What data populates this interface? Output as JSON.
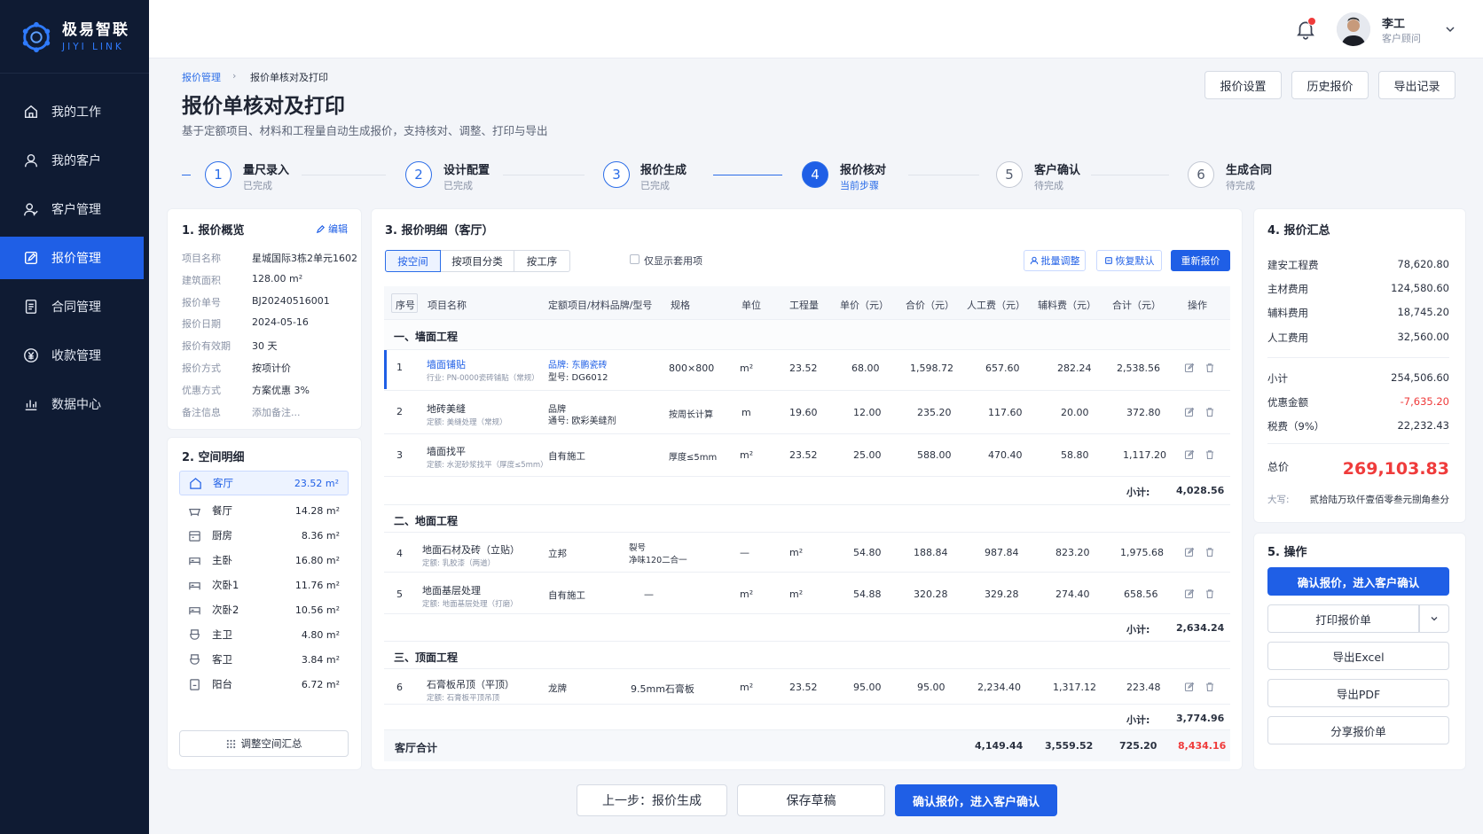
{
  "brand": {
    "name_cn": "极易智联",
    "name_en": "JIYI LINK"
  },
  "nav": [
    {
      "label": "我的工作",
      "icon": "home-icon"
    },
    {
      "label": "我的客户",
      "icon": "user-icon"
    },
    {
      "label": "客户管理",
      "icon": "users-icon"
    },
    {
      "label": "报价管理",
      "icon": "edit-icon",
      "active": true
    },
    {
      "label": "合同管理",
      "icon": "document-icon"
    },
    {
      "label": "收款管理",
      "icon": "yen-icon"
    },
    {
      "label": "数据中心",
      "icon": "chart-icon"
    }
  ],
  "user": {
    "name": "李工",
    "role": "客户顾问"
  },
  "breadcrumb": {
    "parent": "报价管理",
    "current": "报价单核对及打印"
  },
  "page": {
    "title": "报价单核对及打印",
    "subtitle": "基于定额项目、材料和工程量自动生成报价，支持核对、调整、打印与导出"
  },
  "header_buttons": [
    "报价设置",
    "历史报价",
    "导出记录"
  ],
  "steps": [
    {
      "num": "1",
      "label": "量尺录入",
      "status": "已完成"
    },
    {
      "num": "2",
      "label": "设计配置",
      "status": "已完成"
    },
    {
      "num": "3",
      "label": "报价生成",
      "status": "已完成"
    },
    {
      "num": "4",
      "label": "报价核对",
      "status": "当前步骤"
    },
    {
      "num": "5",
      "label": "客户确认",
      "status": "待完成"
    },
    {
      "num": "6",
      "label": "生成合同",
      "status": "待完成"
    }
  ],
  "overview": {
    "title": "1. 报价概览",
    "edit": "编辑",
    "rows": [
      {
        "k": "项目名称",
        "v": "星城国际3栋2单元1602"
      },
      {
        "k": "建筑面积",
        "v": "128.00 m²"
      },
      {
        "k": "报价单号",
        "v": "BJ20240516001"
      },
      {
        "k": "报价日期",
        "v": "2024-05-16"
      },
      {
        "k": "报价有效期",
        "v": "30 天"
      },
      {
        "k": "报价方式",
        "v": "按项计价"
      },
      {
        "k": "优惠方式",
        "v": "方案优惠 3%"
      },
      {
        "k": "备注信息",
        "v": "添加备注..."
      }
    ]
  },
  "spaces": {
    "title": "2. 空间明细",
    "rooms": [
      {
        "name": "客厅",
        "area": "23.52 m²"
      },
      {
        "name": "餐厅",
        "area": "14.28 m²"
      },
      {
        "name": "厨房",
        "area": "8.36 m²"
      },
      {
        "name": "主卧",
        "area": "16.80 m²"
      },
      {
        "name": "次卧1",
        "area": "11.76 m²"
      },
      {
        "name": "次卧2",
        "area": "10.56 m²"
      },
      {
        "name": "主卫",
        "area": "4.80 m²"
      },
      {
        "name": "客卫",
        "area": "3.84 m²"
      },
      {
        "name": "阳台",
        "area": "6.72 m²"
      }
    ],
    "adjust": "调整空间汇总"
  },
  "detail": {
    "title": "3. 报价明细（客厅）",
    "tabs": [
      "按空间",
      "按项目分类",
      "按工序"
    ],
    "only_used": "仅显示套用项",
    "btn_batch": "批量调整",
    "btn_reset": "恢复默认",
    "btn_regen": "重新报价",
    "headers": [
      "序号",
      "项目名称",
      "定额项目/材料品牌/型号",
      "规格",
      "单位",
      "工程量",
      "单价（元）",
      "合价（元）",
      "人工费（元）",
      "辅料费（元）",
      "合计（元）",
      "操作"
    ],
    "sections": [
      {
        "title": "一、墙面工程",
        "subtotal_label": "小计:",
        "subtotal": "4,028.56",
        "rows": [
          {
            "no": "1",
            "name": "墙面铺贴",
            "name_sub": "行业: PN-0000瓷砖铺贴（常规）",
            "mat": "品牌: 东鹏瓷砖",
            "mat_sub": "型号: DG6012",
            "spec": "800×800",
            "unit": "m²",
            "qty": "23.52",
            "price": "68.00",
            "amount": "1,598.72",
            "labor": "657.60",
            "aux": "282.24",
            "total": "2,538.56"
          },
          {
            "no": "2",
            "name": "地砖美缝",
            "name_sub": "定额: 美缝处理（常规）",
            "mat": "品牌",
            "mat_sub": "通号: 欧彩美缝剂",
            "spec": "按周长计算",
            "unit": "m",
            "qty": "19.60",
            "price": "12.00",
            "amount": "235.20",
            "labor": "117.60",
            "aux": "20.00",
            "total": "372.80"
          },
          {
            "no": "3",
            "name": "墙面找平",
            "name_sub": "定额: 水泥砂浆找平（厚度≤5mm）",
            "mat": "自有施工",
            "mat_sub": "",
            "spec": "厚度≤5mm",
            "unit": "m²",
            "qty": "23.52",
            "price": "25.00",
            "amount": "588.00",
            "labor": "470.40",
            "aux": "58.80",
            "total": "1,117.20"
          }
        ]
      },
      {
        "title": "二、地面工程",
        "subtotal_label": "小计:",
        "subtotal": "2,634.24",
        "rows": [
          {
            "no": "4",
            "name": "地面石材及砖（立贴）",
            "name_sub": "定额: 乳胶漆（两道）",
            "mat": "立邦",
            "mat_sub": "",
            "spec": "裂号\n净味120二合一",
            "unit": "—",
            "qty": "m²",
            "price": "54.80",
            "amount": "188.84",
            "labor": "987.84",
            "aux": "823.20",
            "total": "1,975.68"
          },
          {
            "no": "5",
            "name": "地面基层处理",
            "name_sub": "定额: 地面基层处理（打磨）",
            "mat": "自有施工",
            "mat_sub": "",
            "spec": "—",
            "unit": "m²",
            "qty": "m²",
            "price": "54.88",
            "amount": "320.28",
            "labor": "329.28",
            "aux": "274.40",
            "total": "658.56"
          }
        ]
      },
      {
        "title": "三、顶面工程",
        "subtotal_label": "小计:",
        "subtotal": "3,774.96",
        "rows": [
          {
            "no": "6",
            "name": "石膏板吊顶（平顶）",
            "name_sub": "定额: 石膏板平顶吊顶",
            "mat": "龙牌",
            "mat_sub": "",
            "spec": "9.5mm石膏板",
            "unit": "m²",
            "qty": "23.52",
            "price": "95.00",
            "amount": "95.00",
            "labor": "2,234.40",
            "aux": "1,317.12",
            "total": "223.48"
          }
        ]
      }
    ],
    "footer": {
      "label": "客厅合计",
      "a": "4,149.44",
      "b": "3,559.52",
      "c": "725.20",
      "total": "8,434.16"
    }
  },
  "summary": {
    "title": "4. 报价汇总",
    "rows": [
      {
        "k": "建安工程费",
        "v": "78,620.80"
      },
      {
        "k": "主材费用",
        "v": "124,580.60"
      },
      {
        "k": "辅料费用",
        "v": "18,745.20"
      },
      {
        "k": "人工费用",
        "v": "32,560.00"
      }
    ],
    "subtotal_k": "小计",
    "subtotal_v": "254,506.60",
    "discount_k": "优惠金额",
    "discount_v": "-7,635.20",
    "tax_k": "税费（9%）",
    "tax_v": "22,232.43",
    "total_k": "总价",
    "total_v": "269,103.83",
    "caps_k": "大写:",
    "caps_v": "贰拾陆万玖仟壹佰零叁元捌角叁分"
  },
  "actions": {
    "title": "5. 操作",
    "confirm": "确认报价，进入客户确认",
    "print": "打印报价单",
    "excel": "导出Excel",
    "pdf": "导出PDF",
    "share": "分享报价单"
  },
  "footer_buttons": {
    "prev": "上一步：报价生成",
    "save": "保存草稿",
    "confirm": "确认报价，进入客户确认"
  },
  "colors": {
    "sidebar": "#0f1b33",
    "primary": "#1f5fe6",
    "danger": "#ef3b3b"
  }
}
